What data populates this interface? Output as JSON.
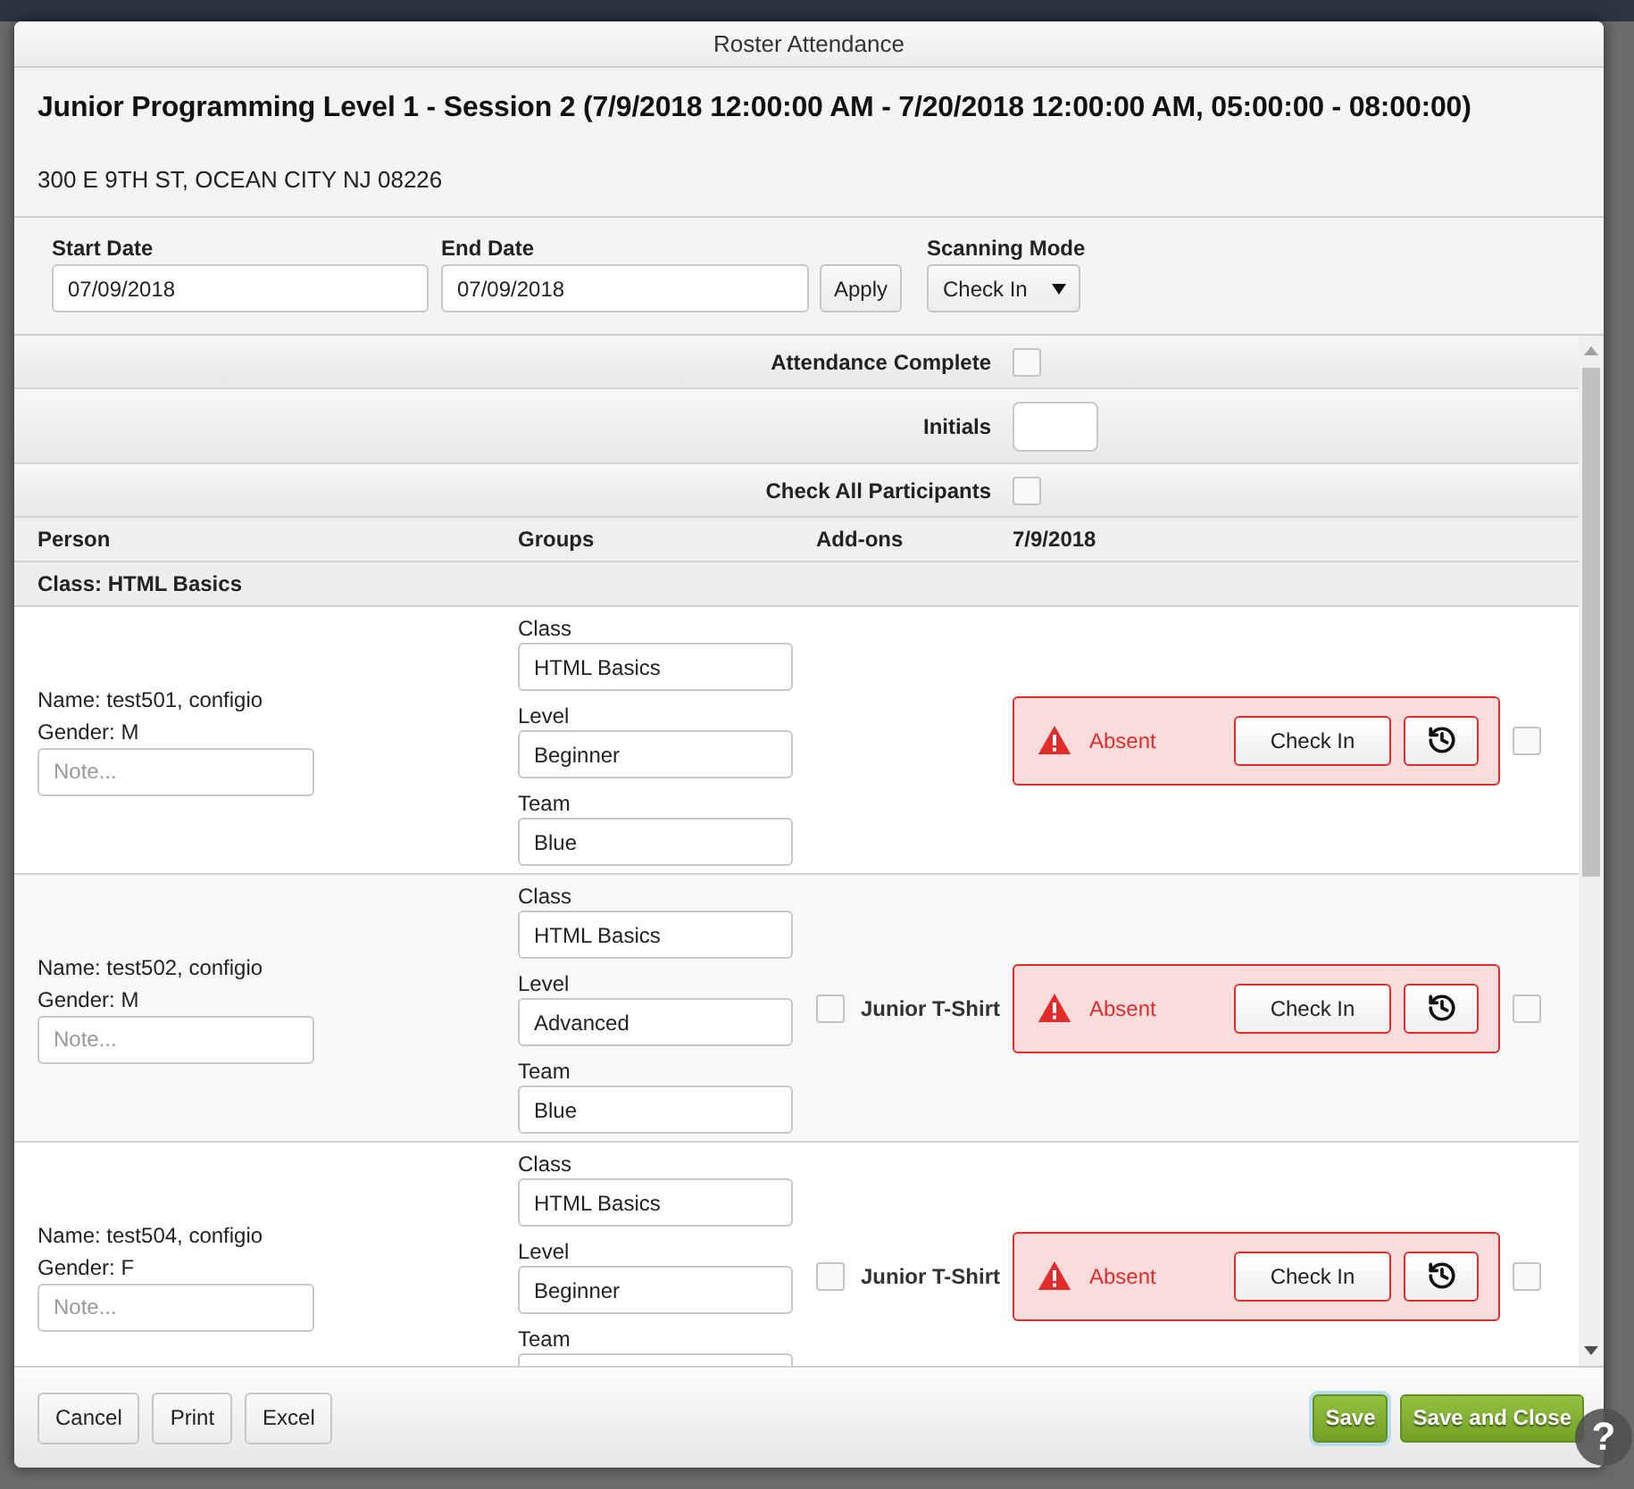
{
  "dialog": {
    "title": "Roster Attendance"
  },
  "header": {
    "session_title": "Junior Programming Level 1 - Session 2 (7/9/2018 12:00:00 AM - 7/20/2018 12:00:00 AM, 05:00:00 - 08:00:00)",
    "address": "300 E 9TH ST, OCEAN CITY NJ 08226"
  },
  "filters": {
    "fields": [
      {
        "label": "Start Date",
        "value": "07/09/2018"
      },
      {
        "label": "End Date",
        "value": "07/09/2018"
      }
    ],
    "apply_button": "Apply",
    "scanning_mode": {
      "label": "Scanning Mode",
      "value": "Check In"
    }
  },
  "options": [
    {
      "kind": "checkbox",
      "label": "Attendance Complete",
      "checked": false
    },
    {
      "kind": "input",
      "label": "Initials"
    },
    {
      "kind": "checkbox",
      "label": "Check All Participants",
      "checked": false
    }
  ],
  "table": {
    "columns": [
      "Person",
      "Groups",
      "Add-ons",
      "7/9/2018"
    ],
    "group_label": "Class: HTML Basics",
    "rows": [
      {
        "name": "Name: test501, configio",
        "gender": "Gender: M",
        "note_placeholder": "Note...",
        "groups": [
          {
            "label": "Class",
            "value": "HTML Basics"
          },
          {
            "label": "Level",
            "value": "Beginner"
          },
          {
            "label": "Team",
            "value": "Blue"
          }
        ],
        "addons": [],
        "status": {
          "kind": "absent",
          "label": "Absent"
        },
        "check_in_button": "Check In",
        "checked": false
      },
      {
        "name": "Name: test502, configio",
        "gender": "Gender: M",
        "note_placeholder": "Note...",
        "groups": [
          {
            "label": "Class",
            "value": "HTML Basics"
          },
          {
            "label": "Level",
            "value": "Advanced"
          },
          {
            "label": "Team",
            "value": "Blue"
          }
        ],
        "addons": [
          {
            "label": "Junior T-Shirt",
            "checked": false
          }
        ],
        "status": {
          "kind": "absent",
          "label": "Absent"
        },
        "check_in_button": "Check In",
        "checked": false
      },
      {
        "name": "Name: test504, configio",
        "gender": "Gender: F",
        "note_placeholder": "Note...",
        "groups": [
          {
            "label": "Class",
            "value": "HTML Basics"
          },
          {
            "label": "Level",
            "value": "Beginner"
          },
          {
            "label": "Team"
          }
        ],
        "addons": [
          {
            "label": "Junior T-Shirt",
            "checked": false
          }
        ],
        "status": {
          "kind": "absent",
          "label": "Absent"
        },
        "check_in_button": "Check In",
        "checked": false
      }
    ]
  },
  "footer": {
    "left_buttons": [
      "Cancel",
      "Print",
      "Excel"
    ],
    "right_buttons": [
      {
        "label": "Save",
        "focused": true
      },
      {
        "label": "Save and Close",
        "focused": false
      }
    ]
  },
  "help_button": "?"
}
